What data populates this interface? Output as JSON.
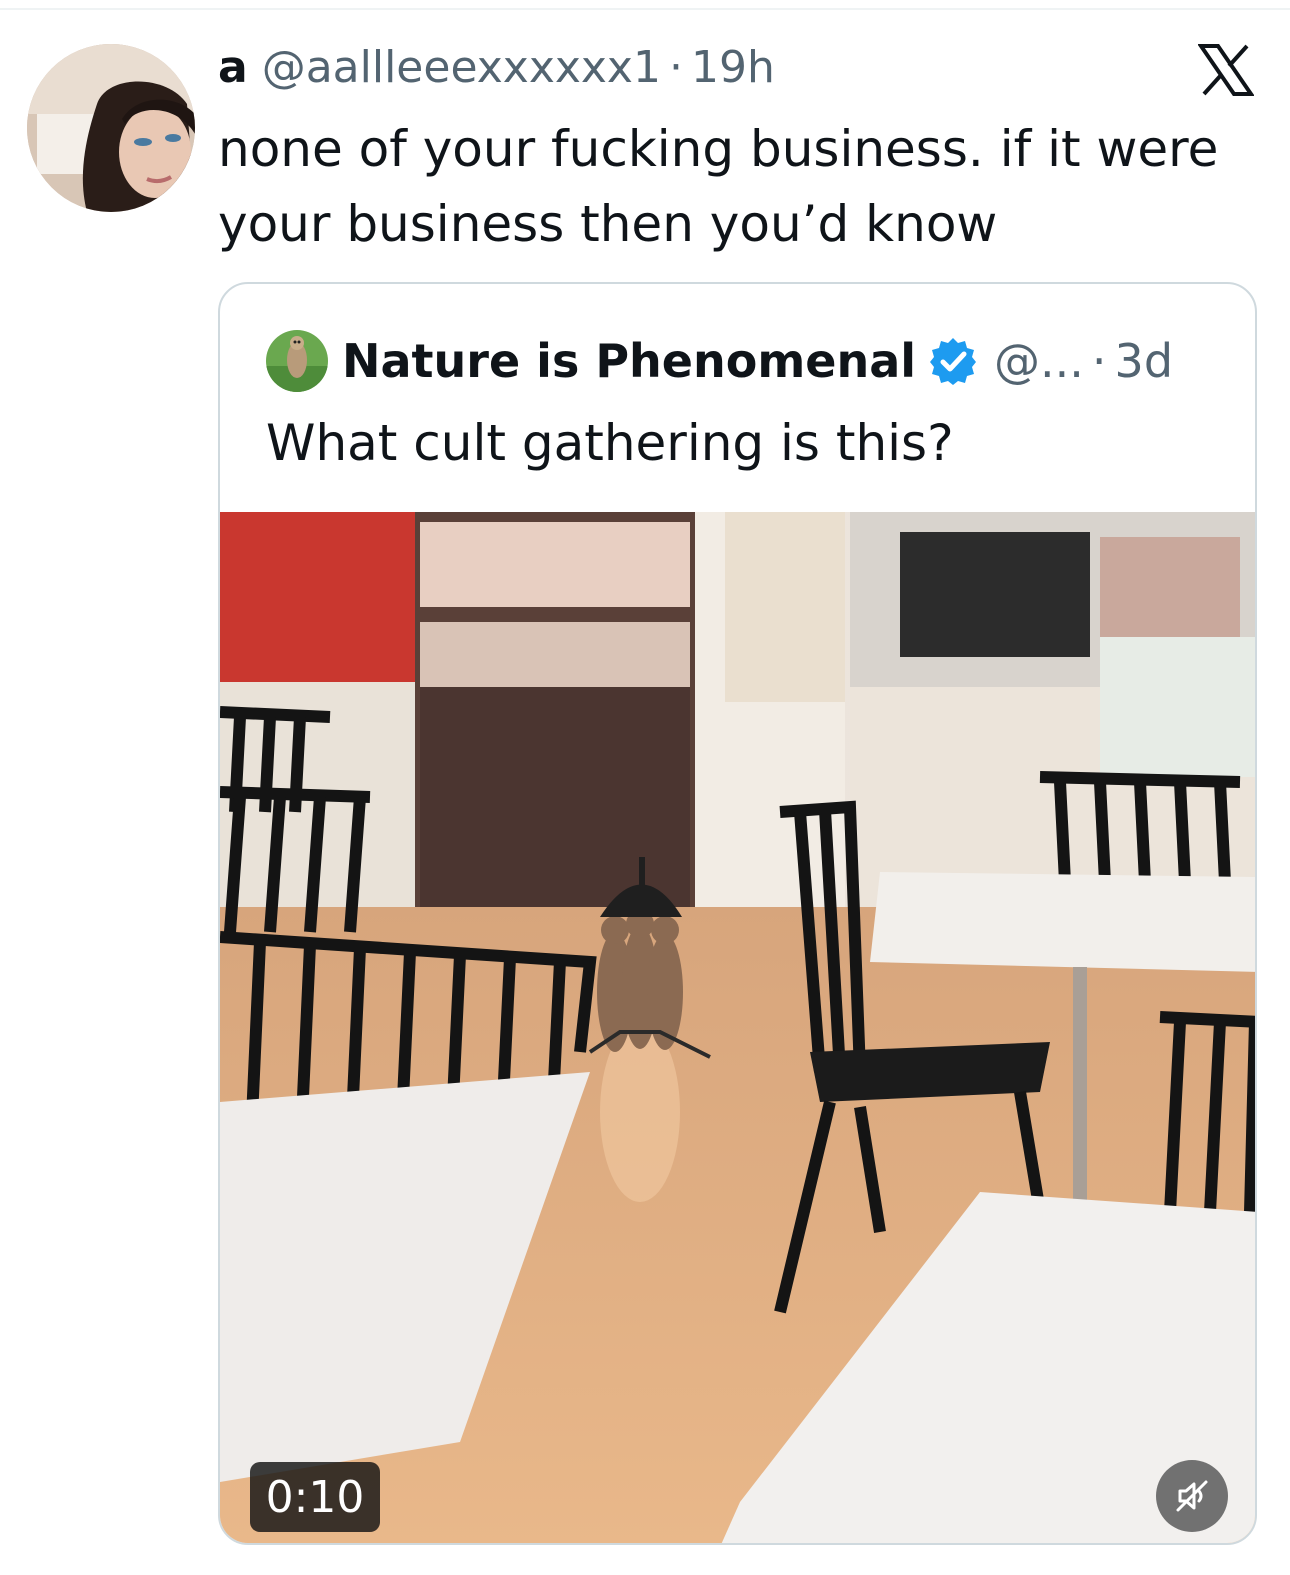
{
  "reply": {
    "name": "a",
    "handle": "@aallleeexxxxxx1",
    "separator": "·",
    "time": "19h",
    "text": "none of your fucking business. if it were your business then you’d know",
    "logo_icon": "x-logo-icon"
  },
  "quote": {
    "name": "Nature is Phenomenal",
    "verified_icon": "verified-badge-icon",
    "handle": "@...",
    "separator": "·",
    "time": "3d",
    "text": "What cult gathering is this?",
    "video": {
      "duration": "0:10",
      "mute_icon": "muted-speaker-icon"
    }
  },
  "colors": {
    "text_primary": "#0f1419",
    "text_secondary": "#536471",
    "border": "#cfd9de",
    "verified": "#1d9bf0"
  }
}
